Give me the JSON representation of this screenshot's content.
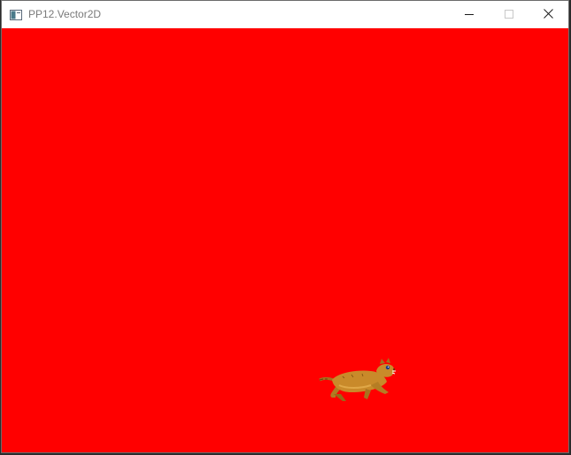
{
  "window": {
    "title": "PP12.Vector2D",
    "icon": "app-window-icon"
  },
  "titlebar_controls": [
    {
      "name": "minimize",
      "icon": "minimize-icon"
    },
    {
      "name": "maximize",
      "icon": "maximize-icon"
    },
    {
      "name": "close",
      "icon": "close-icon"
    }
  ],
  "game": {
    "background_color": "#ff0000",
    "sprite": "cat-sprite"
  },
  "colors": {
    "titlebar_bg": "#ffffff",
    "title_text": "#7a7a7a",
    "canvas_bg": "#ff0000",
    "sprite_body": "#c98a2a"
  }
}
